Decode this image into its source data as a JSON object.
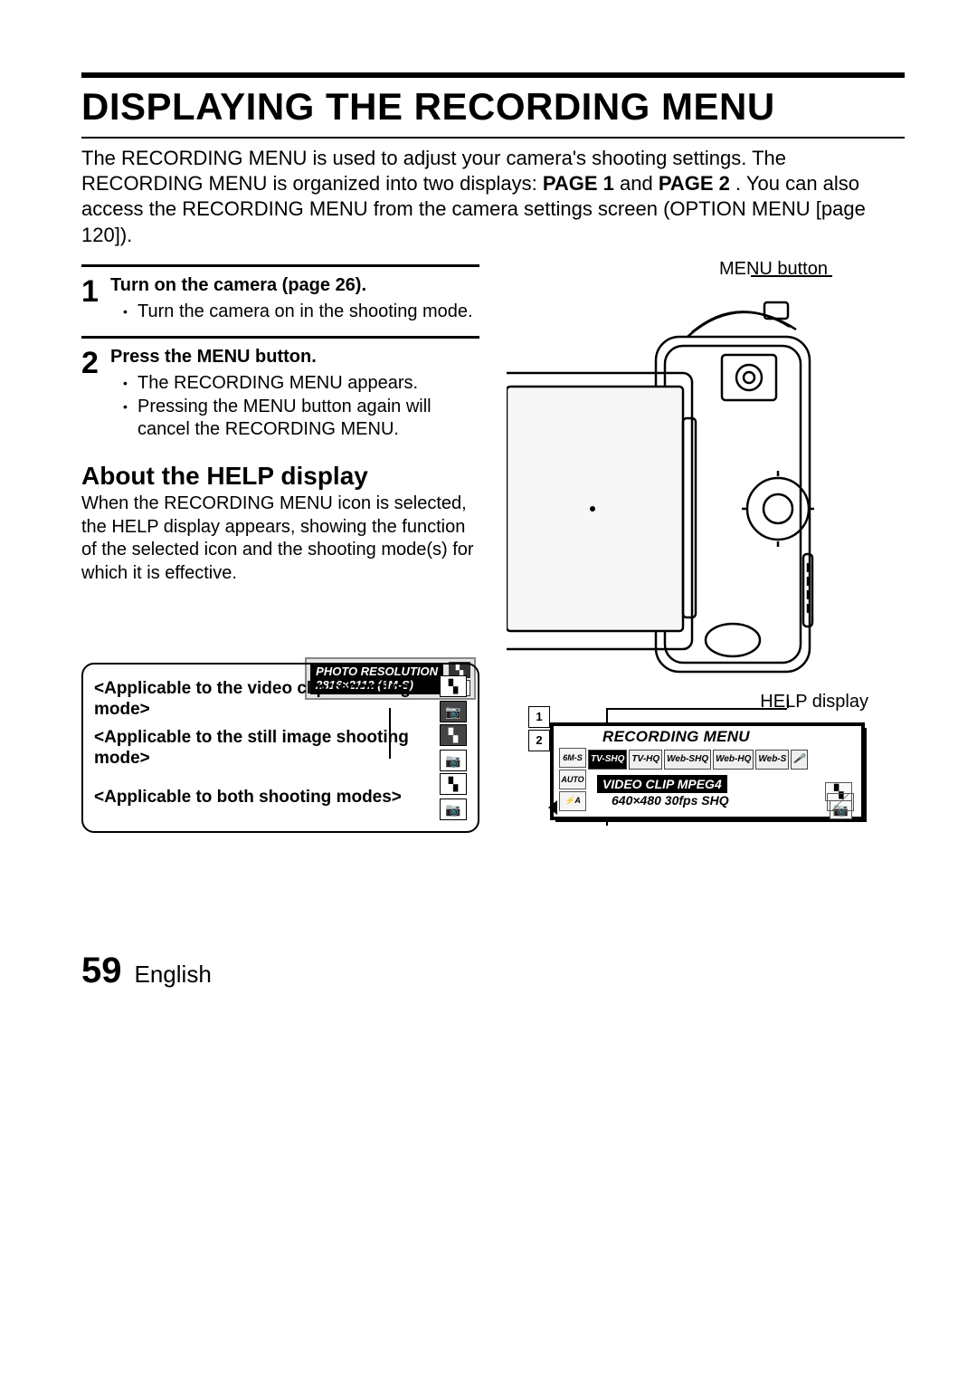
{
  "page": {
    "title": "DISPLAYING THE RECORDING MENU",
    "intro_pre": "The RECORDING MENU is used to adjust your camera's shooting settings. The RECORDING MENU is organized into two displays: ",
    "intro_b1": "PAGE 1",
    "intro_mid": " and ",
    "intro_b2": "PAGE 2",
    "intro_post": ". You can also access the RECORDING MENU from the camera settings screen (OPTION MENU [page 120]).",
    "footer_page": "59",
    "footer_lang": "English"
  },
  "steps": [
    {
      "num": "1",
      "head": "Turn on the camera (page 26).",
      "bullets": [
        "Turn the camera on in the shooting mode."
      ]
    },
    {
      "num": "2",
      "head": "Press the MENU button.",
      "bullets": [
        "The RECORDING MENU appears.",
        "Pressing the MENU button again will cancel the RECORDING MENU."
      ]
    }
  ],
  "about": {
    "heading": "About the HELP display",
    "text": "When the RECORDING MENU icon is selected, the HELP display appears, showing the function of the selected icon and the shooting mode(s) for which it is effective."
  },
  "figure": {
    "label_menu": "MENU button",
    "label_help": "HELP display"
  },
  "rec_menu": {
    "title": "RECORDING MENU",
    "tabs": [
      "1",
      "2"
    ],
    "top_row": [
      "TV-SHQ",
      "TV-HQ",
      "Web-SHQ",
      "Web-HQ",
      "Web-S",
      "🎤"
    ],
    "side_col": [
      "6M-S",
      "AUTO",
      "⚡A"
    ],
    "vid_label": "VIDEO CLIP MPEG4",
    "vid_res": "640×480 30fps SHQ"
  },
  "photo_chip": {
    "line1": "PHOTO RESOLUTION",
    "line2": "2816×2112 (6M-S)"
  },
  "app_box": {
    "rows": [
      {
        "label": "<Applicable to the video clip recording mode>",
        "icons": [
          "vc",
          "dim"
        ]
      },
      {
        "label": "<Applicable to the still image shooting mode>",
        "icons": [
          "dim",
          "cam"
        ]
      },
      {
        "label": "<Applicable to both shooting modes>",
        "icons": [
          "vc",
          "cam"
        ]
      }
    ]
  }
}
